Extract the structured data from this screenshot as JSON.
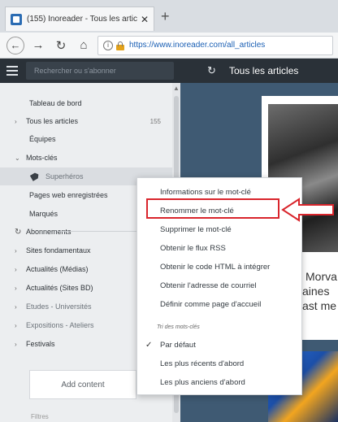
{
  "browser": {
    "tab_title": "(155) Inoreader - Tous les artic",
    "new_tab": "+",
    "url": "https://www.inoreader.com/all_articles"
  },
  "app": {
    "search_placeholder": "Rechercher ou s'abonner",
    "main_title": "Tous les articles"
  },
  "sidebar": {
    "dashboard": "Tableau de bord",
    "all_articles": "Tous les articles",
    "all_articles_count": "155",
    "teams": "Équipes",
    "tags": "Mots-clés",
    "tag_item": "Superhéros",
    "saved_pages": "Pages web enregistrées",
    "starred": "Marqués",
    "subscriptions": "Abonnements",
    "folders": [
      "Sites fondamentaux",
      "Actualités (Médias)",
      "Actualités (Sites BD)",
      "Etudes - Universités",
      "Expositions - Ateliers",
      "Festivals"
    ],
    "add_content": "Add content",
    "filters": "Filtres"
  },
  "context_menu": {
    "items": [
      "Informations sur le mot-clé",
      "Renommer le mot-clé",
      "Supprimer le mot-clé",
      "Obtenir le flux RSS",
      "Obtenir le code HTML à intégrer",
      "Obtenir l'adresse de courriel",
      "Définir comme page d'accueil"
    ],
    "sort_heading": "Tri des mots-clés",
    "sort_options": [
      "Par défaut",
      "Les plus récents d'abord",
      "Les plus anciens d'abord"
    ]
  },
  "article": {
    "line1": "Morva",
    "line2": "aines",
    "line3": "ast me"
  },
  "colors": {
    "header_bg": "#2a3138",
    "sidebar_bg": "#eceef0",
    "highlight": "#d9252c",
    "main_bg": "#3f5a73"
  }
}
